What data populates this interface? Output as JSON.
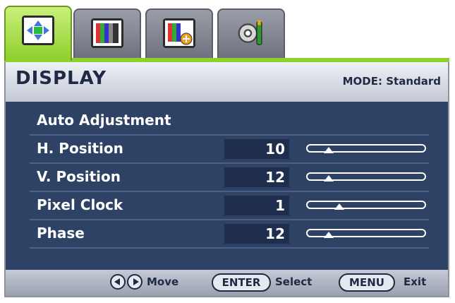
{
  "tabs": [
    {
      "icon": "display-icon",
      "active": true
    },
    {
      "icon": "picture-icon",
      "active": false
    },
    {
      "icon": "picture-advanced-icon",
      "active": false
    },
    {
      "icon": "system-settings-icon",
      "active": false
    }
  ],
  "header": {
    "title": "DISPLAY",
    "mode": "MODE: Standard"
  },
  "menu": {
    "items": [
      {
        "label": "Auto Adjustment"
      },
      {
        "label": "H. Position",
        "value": "10",
        "level": 0.15
      },
      {
        "label": "V. Position",
        "value": "12",
        "level": 0.15
      },
      {
        "label": "Pixel Clock",
        "value": "1",
        "level": 0.25
      },
      {
        "label": "Phase",
        "value": "12",
        "level": 0.15
      }
    ]
  },
  "footer": {
    "move_label": "Move",
    "enter_label": "ENTER",
    "select_label": "Select",
    "menu_label": "MENU",
    "exit_label": "Exit"
  },
  "colors": {
    "accent": "#8fcf2e",
    "panel": "#2e4266",
    "text": "#ffffff"
  }
}
